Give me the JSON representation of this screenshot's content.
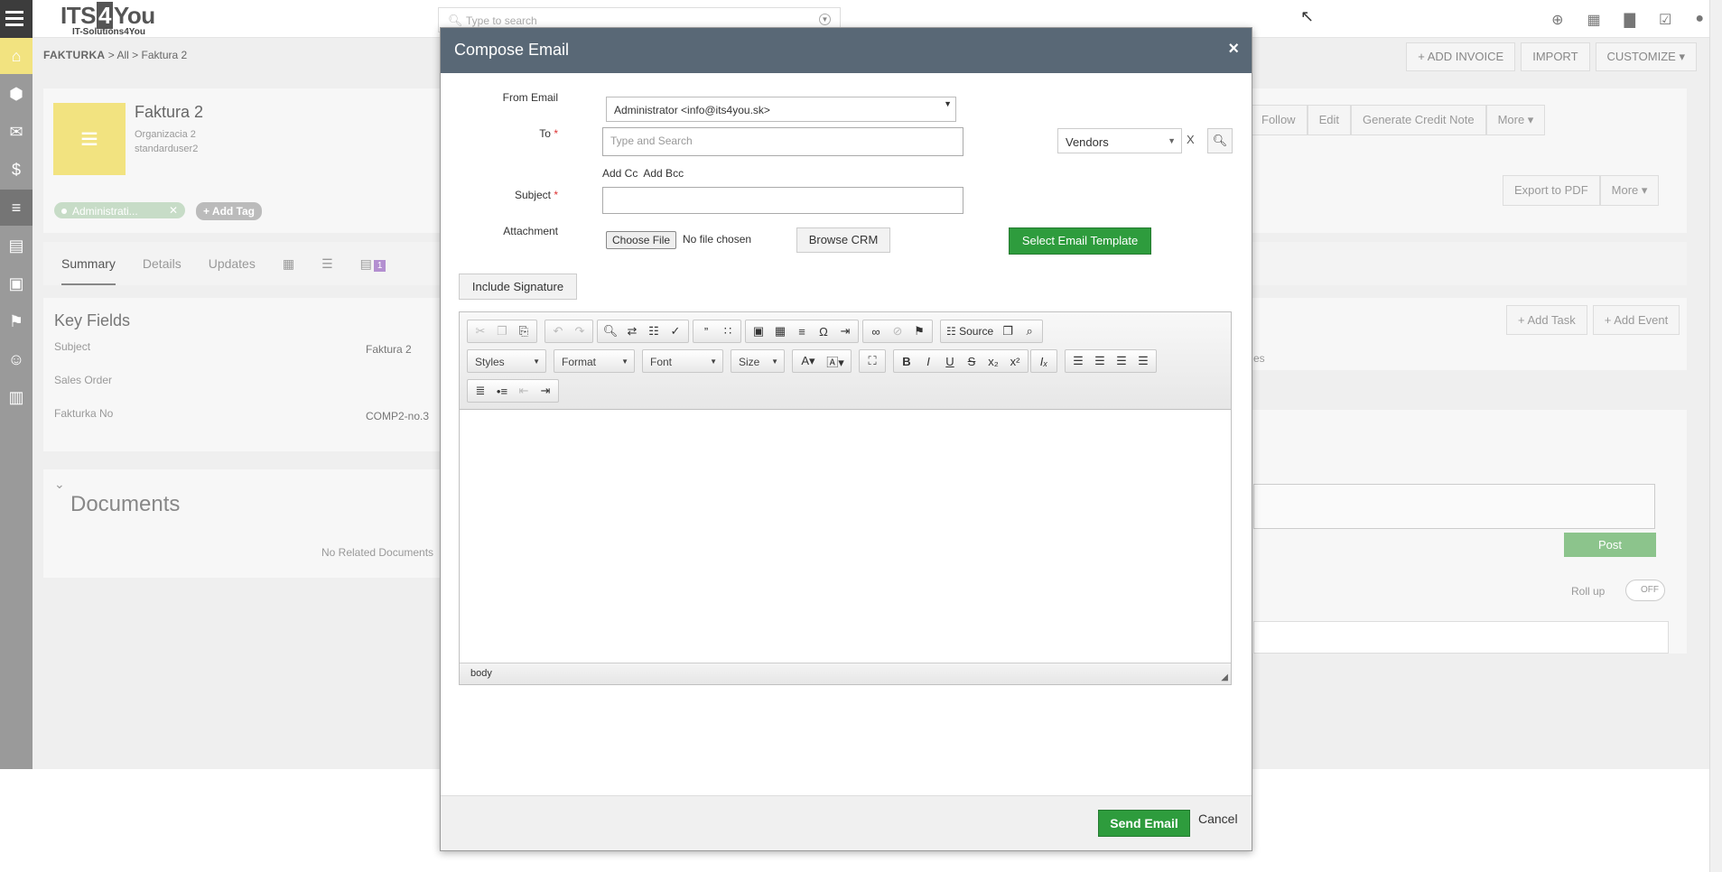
{
  "app": {
    "logo_main_a": "ITS",
    "logo_main_4": "4",
    "logo_main_b": "You",
    "logo_sub": "IT-Solutions4You",
    "search_placeholder": "Type to search"
  },
  "breadcrumb": {
    "module": "FAKTURKA",
    "sep1": ">",
    "all": "All",
    "sep2": ">",
    "record": "Faktura 2"
  },
  "header_actions": {
    "add_invoice": "+ ADD INVOICE",
    "import": "IMPORT",
    "customize": "CUSTOMIZE ▾"
  },
  "record": {
    "title": "Faktura 2",
    "organization": "Organizacia 2",
    "assigned": "standarduser2",
    "tag_label": "Administrati...",
    "add_tag": "+ Add Tag",
    "tabs": [
      "Summary",
      "Details",
      "Updates"
    ],
    "tab_badge": "1",
    "actions": [
      "Follow",
      "Edit",
      "Generate Credit Note",
      "More ▾"
    ],
    "actions2": [
      "Export to PDF",
      "More ▾"
    ],
    "activity_actions": [
      "+ Add Task",
      "+ Add Event"
    ],
    "activity_partial": "es",
    "post": "Post",
    "rollup": "Roll up",
    "rollup_state": "OFF"
  },
  "key_fields": {
    "title": "Key Fields",
    "rows": [
      {
        "label": "Subject",
        "value": "Faktura 2"
      },
      {
        "label": "Sales Order",
        "value": ""
      },
      {
        "label": "Fakturka No",
        "value": "COMP2-no.3"
      }
    ]
  },
  "documents": {
    "toggle": "⌄",
    "title": "Documents",
    "empty": "No Related Documents"
  },
  "modal": {
    "title": "Compose Email",
    "close": "×",
    "from_label": "From Email",
    "from_value": "Administrator <info@its4you.sk>",
    "to_label": "To",
    "to_placeholder": "Type and Search",
    "add_cc": "Add Cc",
    "add_bcc": "Add Bcc",
    "subject_label": "Subject",
    "subject_value": "",
    "required_mark": "*",
    "attachment_label": "Attachment",
    "choose_file": "Choose File",
    "no_file": "No file chosen",
    "browse_crm": "Browse CRM",
    "select_template": "Select Email Template",
    "related_module": "Vendors",
    "related_clear": "X",
    "include_signature": "Include Signature",
    "toolbar": {
      "source": "Source",
      "styles": "Styles",
      "format": "Format",
      "font": "Font",
      "size": "Size"
    },
    "status_path": "body",
    "send": "Send Email",
    "cancel": "Cancel"
  },
  "colors": {
    "modal_header": "#596876",
    "primary_green": "#2e9c3d",
    "module_accent": "#f2e380"
  }
}
